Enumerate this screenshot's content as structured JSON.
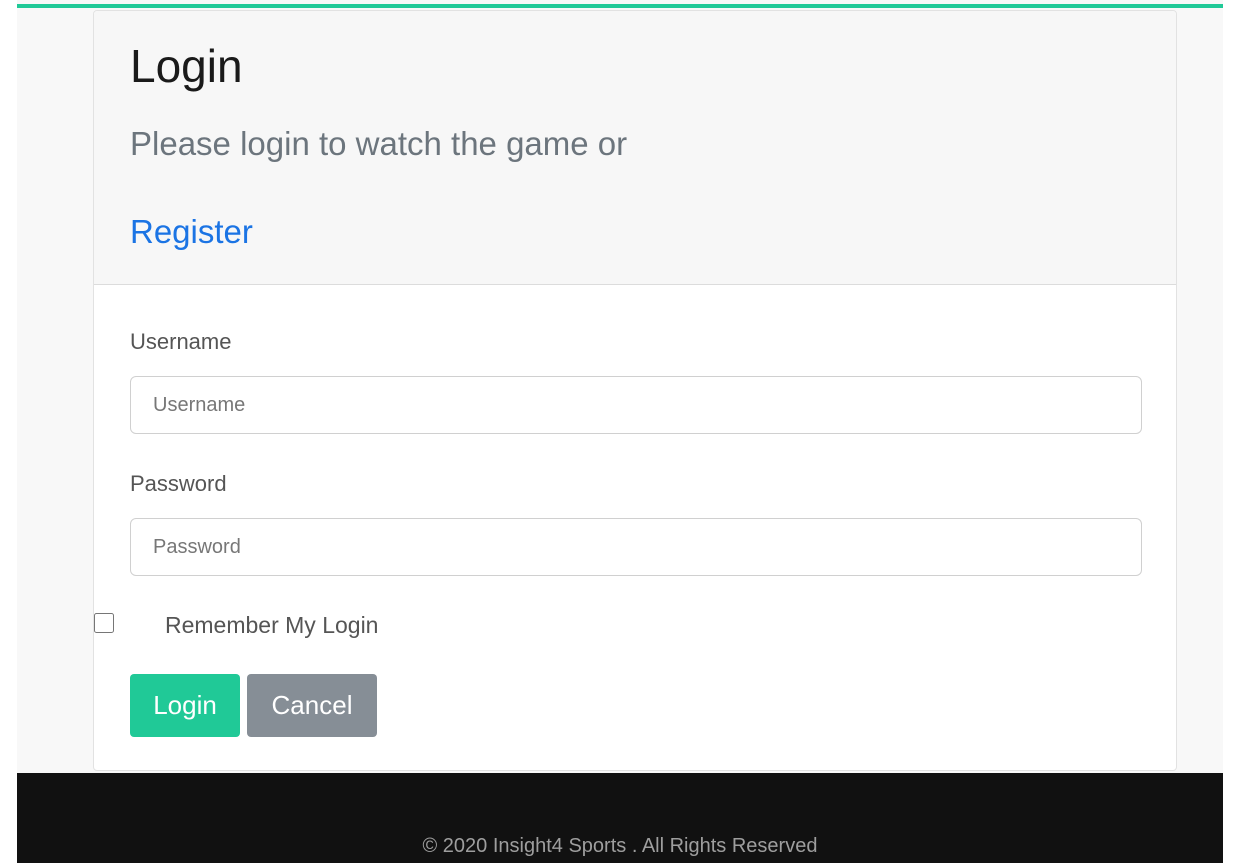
{
  "colors": {
    "accent": "#20c997",
    "link": "#1b74e4",
    "cancel": "#868e96",
    "footer_bg": "#111111"
  },
  "login_card": {
    "title": "Login",
    "subtitle": "Please login to watch the game or",
    "register_link": "Register"
  },
  "form": {
    "username": {
      "label": "Username",
      "placeholder": "Username",
      "value": ""
    },
    "password": {
      "label": "Password",
      "placeholder": "Password",
      "value": ""
    },
    "remember": {
      "label": "Remember My Login",
      "checked": false
    },
    "login_button": "Login",
    "cancel_button": "Cancel"
  },
  "footer": {
    "copyright": "© 2020 Insight4 Sports . All Rights Reserved"
  }
}
